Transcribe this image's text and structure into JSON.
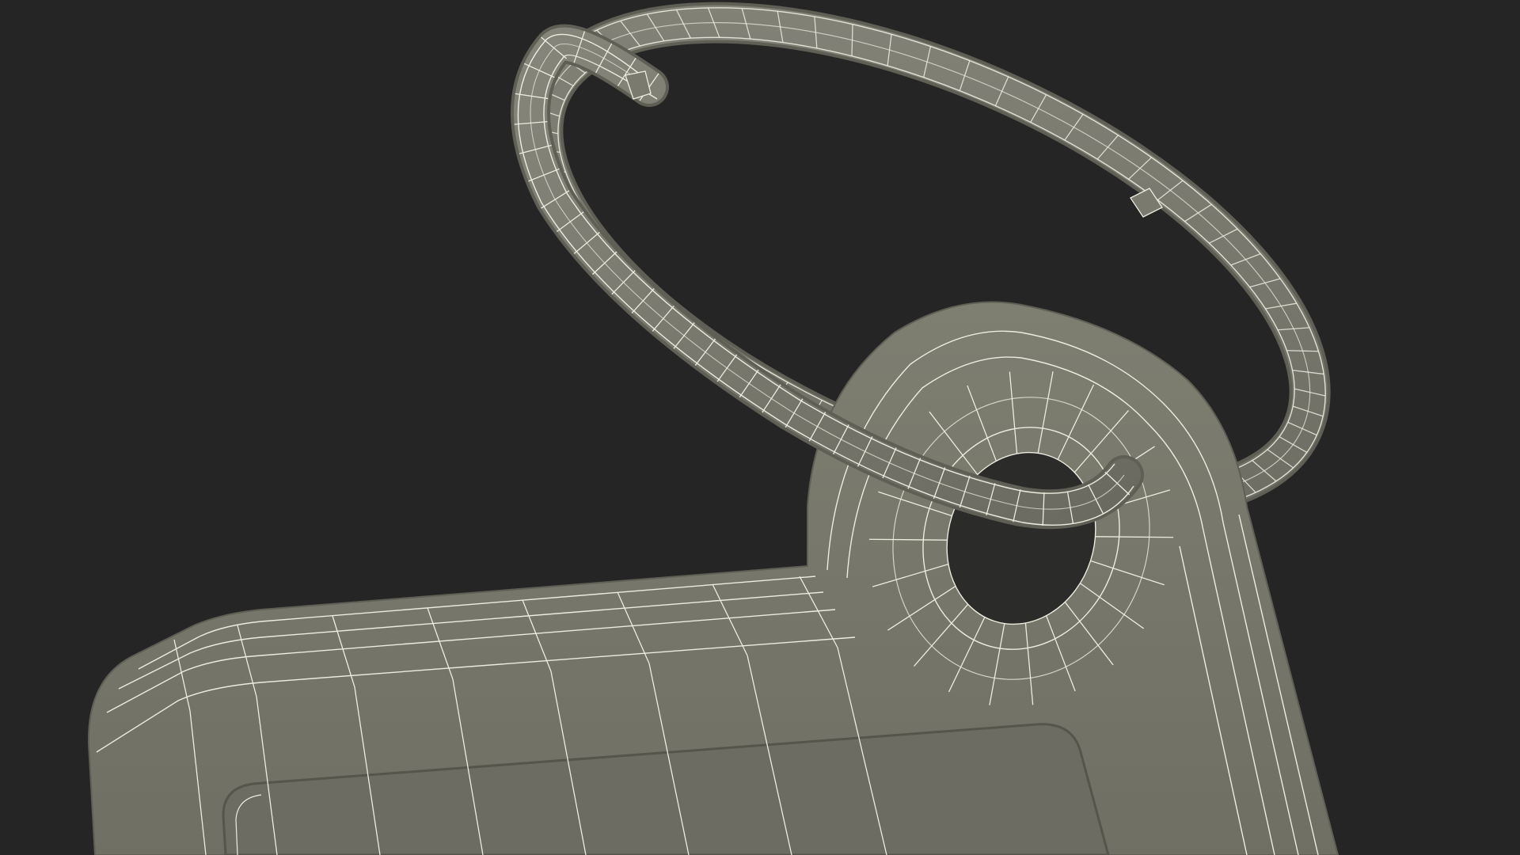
{
  "scene": {
    "background_color": "#252525",
    "model_fill": "#767669",
    "model_shadow": "#5f5f55",
    "model_highlight": "#848476",
    "wire_color": "#ececdf",
    "recess_fill": "#6c6c62"
  }
}
